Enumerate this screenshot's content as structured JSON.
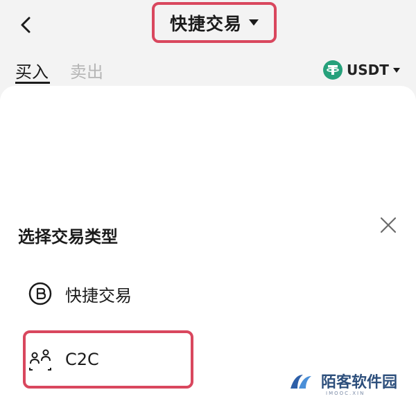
{
  "header": {
    "title": "快捷交易"
  },
  "tabs": [
    {
      "label": "买入"
    },
    {
      "label": "卖出"
    }
  ],
  "currency": {
    "label": "USDT",
    "icon": "tether-icon",
    "color": "#26a17b"
  },
  "sheet": {
    "title": "选择交易类型",
    "options": [
      {
        "label": "快捷交易",
        "icon": "bitcoin-circle-icon"
      },
      {
        "label": "C2C",
        "icon": "people-scan-icon"
      }
    ]
  },
  "watermark": {
    "text": "陌客软件园",
    "sub": "IMOOC.XIN"
  },
  "colors": {
    "highlight": "#d9475e",
    "accent_text": "#1b1b1b",
    "inactive_text": "#b5b5b5"
  }
}
